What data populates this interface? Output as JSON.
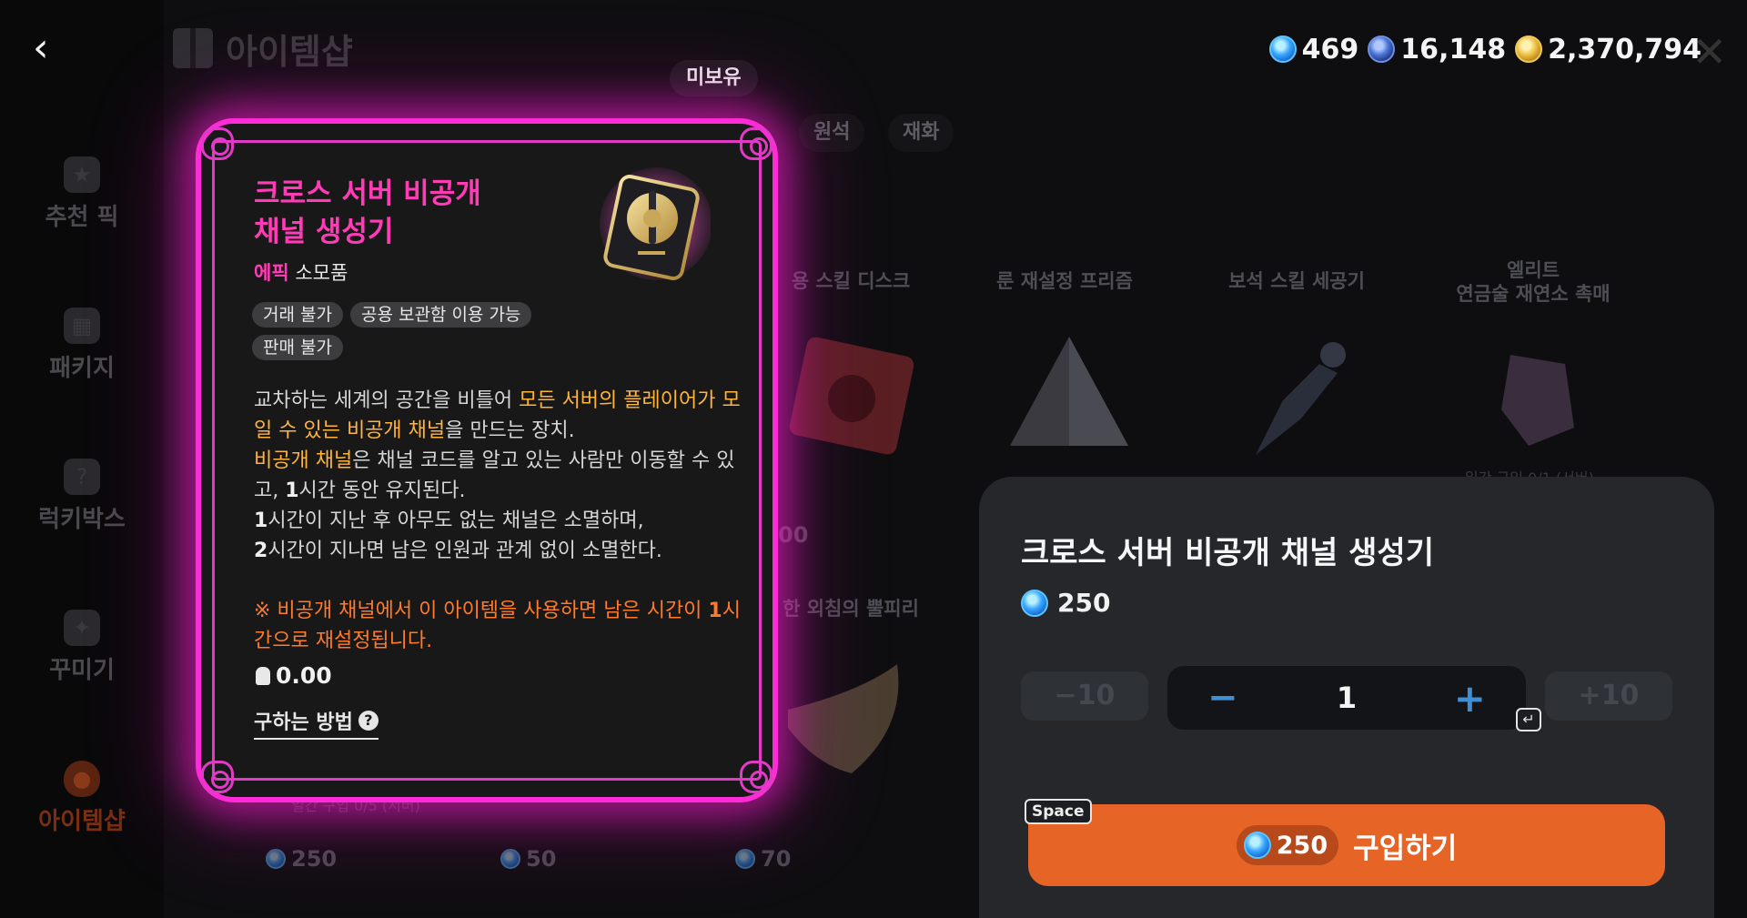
{
  "header": {
    "title": "아이템샵",
    "currencies": [
      {
        "icon": "blue-gem-icon",
        "value": "469"
      },
      {
        "icon": "dark-gem-icon",
        "value": "16,148"
      },
      {
        "icon": "gold-coin-icon",
        "value": "2,370,794"
      }
    ]
  },
  "sidebar": {
    "items": [
      {
        "label": "추천 픽",
        "icon": "star-icon"
      },
      {
        "label": "패키지",
        "icon": "package-icon"
      },
      {
        "label": "럭키박스",
        "icon": "lucky-box-icon"
      },
      {
        "label": "꾸미기",
        "icon": "wand-icon"
      },
      {
        "label": "아이템샵",
        "icon": "pouch-icon",
        "active": true
      }
    ]
  },
  "tabs": [
    "원석",
    "재화"
  ],
  "grid": {
    "names": [
      "용 스킬 디스크",
      "룬 재설정 프리즘",
      "보석 스킬 세공기",
      "엘리트\n연금술 재연소 촉매",
      "한 외침의 뿔피리"
    ],
    "limits": [
      "일간 구입 0/1 (서버)",
      "일간 구입 0/5 (서버)"
    ],
    "prices": [
      "250",
      "50",
      "70"
    ],
    "partial_price": "00"
  },
  "tooltip": {
    "ownership": "미보유",
    "title": "크로스 서버 비공개\n채널 생성기",
    "grade": "에픽",
    "type": "소모품",
    "tags": [
      "거래 불가",
      "공용 보관함 이용 가능",
      "판매 불가"
    ],
    "desc": {
      "p1a": "교차하는 세계의 공간을 비틀어 ",
      "p1b": "모든 서버의 플레이어가 모일 수 있는 비공개 채널",
      "p1c": "을 만드는 장치.",
      "p2a": "비공개 채널",
      "p2b": "은 채널 코드를 알고 있는 사람만 이동할 수 있고, ",
      "p2c": "1",
      "p2d": "시간 동안 유지된다.",
      "p3a": "1",
      "p3b": "시간이 지난 후 아무도 없는 채널은 소멸하며,",
      "p4a": "2",
      "p4b": "시간이 지나면 남은 인원과 관계 없이 소멸한다.",
      "warn1": "※ 비공개 채널에서 이 아이템을 사용하면 남은 시간이 ",
      "warn2": "1",
      "warn3": "시간으로 재설정됩니다."
    },
    "weight": "0.00",
    "how_to": "구하는 방법"
  },
  "purchase": {
    "title": "크로스 서버 비공개 채널 생성기",
    "price": "250",
    "minus10": "−10",
    "plus10": "+10",
    "quantity": "1",
    "space_key": "Space",
    "enter_key": "↵",
    "buy_price": "250",
    "buy_label": "구입하기"
  },
  "colors": {
    "epic": "#ff3cb6",
    "highlight": "#ffb43c",
    "warning": "#ff7a2a",
    "buy_button": "#e56426",
    "card_glow": "#ff2bd8"
  }
}
